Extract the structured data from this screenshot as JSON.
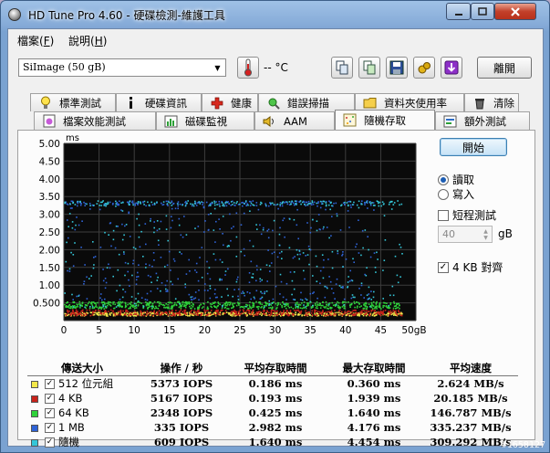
{
  "window": {
    "title": "HD Tune Pro 4.60 - 硬碟檢測-維護工具"
  },
  "menu": [
    {
      "label": "檔案",
      "key": "F"
    },
    {
      "label": "說明",
      "key": "H"
    }
  ],
  "toolbar": {
    "drive": "SiImage  (50 gB)",
    "temperature": "-- °C",
    "exit_label": "離開",
    "icons": [
      "copy-icon",
      "copy-screenshot-icon",
      "save-icon",
      "options-icon",
      "download-icon"
    ]
  },
  "tabs_row1": [
    {
      "label": "標準測試",
      "icon": "lightbulb-icon"
    },
    {
      "label": "硬碟資訊",
      "icon": "info-icon"
    },
    {
      "label": "健康",
      "icon": "health-cross-icon"
    },
    {
      "label": "錯誤掃描",
      "icon": "scan-icon"
    },
    {
      "label": "資料夾使用率",
      "icon": "folder-icon"
    },
    {
      "label": "清除",
      "icon": "trash-icon"
    }
  ],
  "tabs_row2": [
    {
      "label": "檔案效能測試",
      "icon": "file-benchmark-icon"
    },
    {
      "label": "磁碟監視",
      "icon": "monitor-icon"
    },
    {
      "label": "AAM",
      "icon": "speaker-icon"
    },
    {
      "label": "隨機存取",
      "icon": "random-access-icon",
      "active": true
    },
    {
      "label": "額外測試",
      "icon": "extra-tests-icon"
    }
  ],
  "controls": {
    "start_label": "開始",
    "read_label": "讀取",
    "write_label": "寫入",
    "short_test_label": "短程測試",
    "short_test_value": "40",
    "gb_label": "gB",
    "align_label": "4 KB 對齊",
    "read_selected": true,
    "align_checked": true
  },
  "chart_data": {
    "type": "scatter",
    "ylabel": "ms",
    "xlabel": "",
    "x_ticks": [
      "0",
      "5",
      "10",
      "15",
      "20",
      "25",
      "30",
      "35",
      "40",
      "45",
      "50gB"
    ],
    "y_ticks": [
      "5.00",
      "4.50",
      "4.00",
      "3.50",
      "3.00",
      "2.50",
      "2.00",
      "1.50",
      "1.00",
      "0.500"
    ],
    "xlim": [
      0,
      50
    ],
    "ylim": [
      0,
      5
    ],
    "grid": true,
    "series": [
      {
        "name": "512 位元組",
        "color": "#f4e84a",
        "band": [
          0.15,
          0.25
        ],
        "density": 500,
        "xmax": 48
      },
      {
        "name": "4 KB",
        "color": "#c8221b",
        "band": [
          0.16,
          0.32
        ],
        "density": 450,
        "xmax": 48
      },
      {
        "name": "64 KB",
        "color": "#2fd23a",
        "band": [
          0.35,
          0.55
        ],
        "density": 600,
        "xmax": 48
      },
      {
        "name": "1 MB",
        "color": "#2f63d6",
        "band": [
          0.6,
          3.4
        ],
        "density": 500,
        "xmax": 44
      },
      {
        "name": "隨機",
        "color": "#34c6d8",
        "band": [
          0.4,
          3.4
        ],
        "density": 420,
        "xmax": 48
      }
    ]
  },
  "results": {
    "headers": [
      "傳送大小",
      "操作 / 秒",
      "平均存取時間",
      "最大存取時間",
      "平均速度"
    ],
    "rows": [
      {
        "name": "512 位元組",
        "color": "#f4e84a",
        "ops": "5373 IOPS",
        "avg": "0.186 ms",
        "max": "0.360 ms",
        "speed": "2.624 MB/s"
      },
      {
        "name": "4 KB",
        "color": "#c8221b",
        "ops": "5167 IOPS",
        "avg": "0.193 ms",
        "max": "1.939 ms",
        "speed": "20.185 MB/s"
      },
      {
        "name": "64 KB",
        "color": "#2fd23a",
        "ops": "2348 IOPS",
        "avg": "0.425 ms",
        "max": "1.640 ms",
        "speed": "146.787 MB/s"
      },
      {
        "name": "1 MB",
        "color": "#2f63d6",
        "ops": "335 IOPS",
        "avg": "2.982 ms",
        "max": "4.176 ms",
        "speed": "335.237 MB/s"
      },
      {
        "name": "隨機",
        "color": "#34c6d8",
        "ops": "609 IOPS",
        "avg": "1.640 ms",
        "max": "4.454 ms",
        "speed": "309.292 MB/s"
      }
    ]
  },
  "watermark": "#1658127"
}
